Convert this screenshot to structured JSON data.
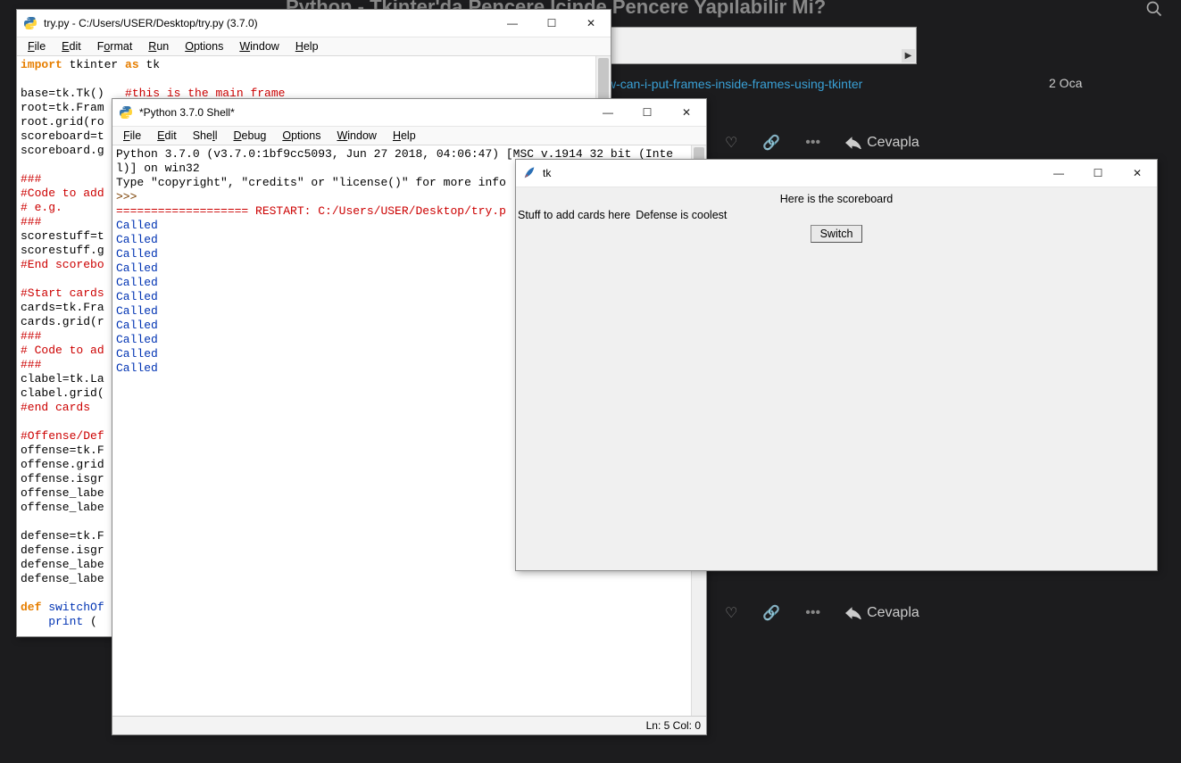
{
  "forum": {
    "title": "Python - Tkinter'da Pencere İçinde Pencere Yapılabilir Mi?",
    "link_text": "w-can-i-put-frames-inside-frames-using-tkinter",
    "date": "2 Oca",
    "reply_label": "Cevapla",
    "heart": "♡",
    "link_icon": "🔗",
    "dots": "•••"
  },
  "editor": {
    "title": "try.py - C:/Users/USER/Desktop/try.py (3.7.0)",
    "menus": [
      "File",
      "Edit",
      "Format",
      "Run",
      "Options",
      "Window",
      "Help"
    ]
  },
  "shell": {
    "title": "*Python 3.7.0 Shell*",
    "menus": [
      "File",
      "Edit",
      "Shell",
      "Debug",
      "Options",
      "Window",
      "Help"
    ],
    "header_a": "Python 3.7.0 (v3.7.0:1bf9cc5093, Jun 27 2018, 04:06:47) [MSC v.1914 32 bit (Inte",
    "header_b": "l)] on win32",
    "header_c": "Type \"copyright\", \"credits\" or \"license()\" for more info",
    "prompt": ">>>",
    "restart": "=================== RESTART: C:/Users/USER/Desktop/try.p",
    "called": "Called",
    "status": "Ln: 5  Col: 0"
  },
  "tk": {
    "title": "tk",
    "scoreboard": "Here is the scoreboard",
    "cards": "Stuff to add cards here",
    "defense": "Defense is coolest",
    "switch": "Switch"
  },
  "code": {
    "l1a": "import",
    "l1b": " tkinter ",
    "l1c": "as",
    "l1d": " tk",
    "l3": "base=tk.Tk()   ",
    "l3c": "#this is the main frame",
    "l4": "root=tk.Fram",
    "l5": "root.grid(ro",
    "l6": "scoreboard=t",
    "l7": "scoreboard.g",
    "l9": "###",
    "l10": "#Code to add",
    "l11": "# e.g.",
    "l12": "###",
    "l13": "scorestuff=t",
    "l14": "scorestuff.g",
    "l15": "#End scorebo",
    "l17": "#Start cards",
    "l18": "cards=tk.Fra",
    "l19": "cards.grid(r",
    "l20": "###",
    "l21": "# Code to ad",
    "l22": "###",
    "l23": "clabel=tk.La",
    "l24": "clabel.grid(",
    "l25": "#end cards",
    "l27": "#Offense/Def",
    "l28": "offense=tk.F",
    "l29": "offense.grid",
    "l30": "offense.isgr",
    "l31": "offense_labe",
    "l32": "offense_labe",
    "l34": "defense=tk.F",
    "l35": "defense.isgr",
    "l36": "defense_labe",
    "l37": "defense_labe",
    "l39a": "def",
    "l39b": " switchOf",
    "l40a": "    print ",
    "l40b": "("
  }
}
